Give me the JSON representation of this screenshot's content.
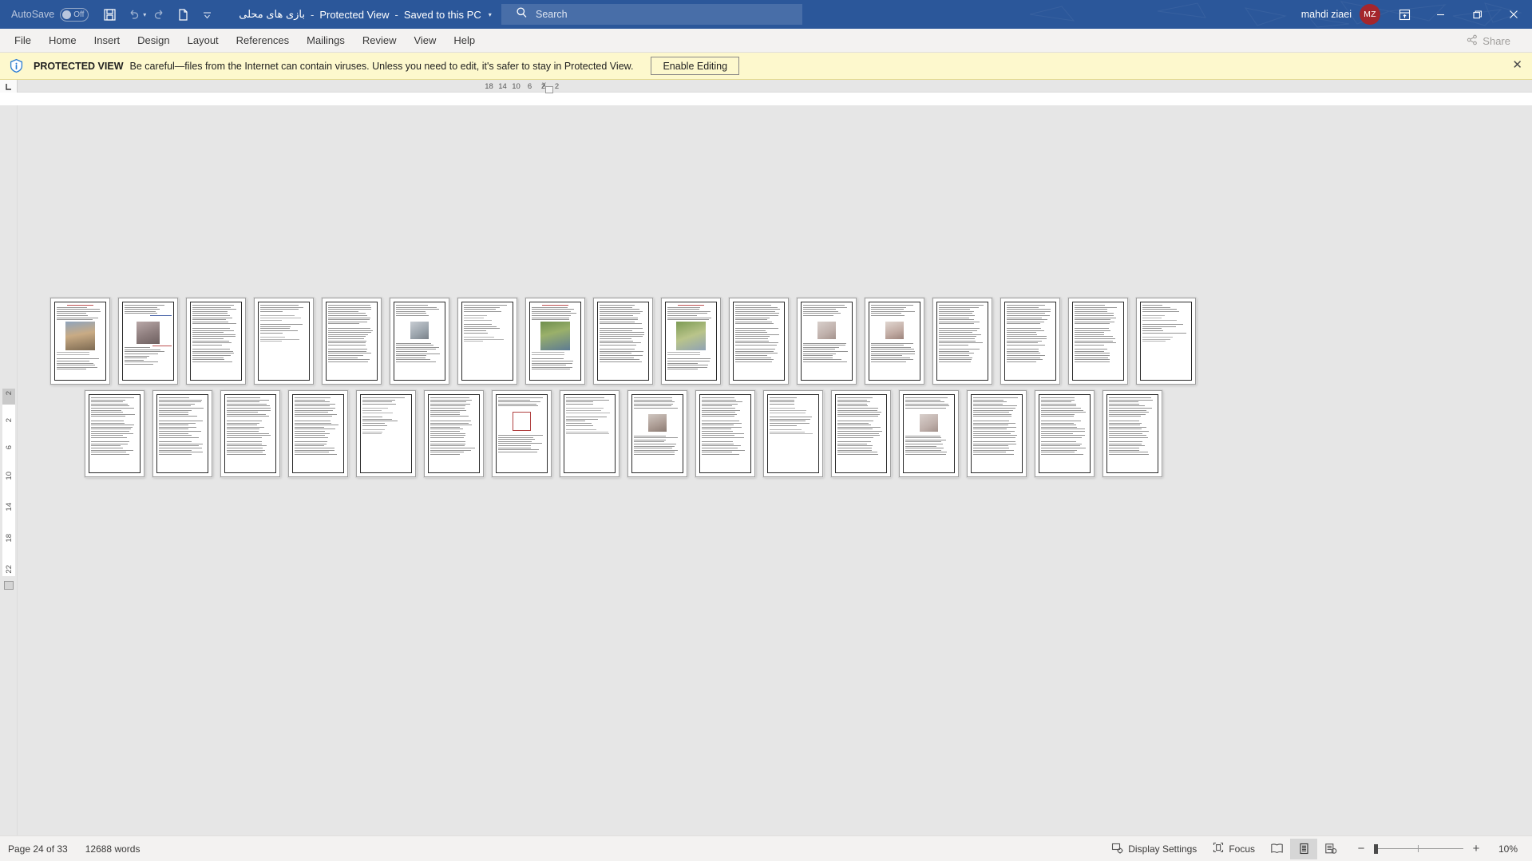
{
  "titlebar": {
    "autosave_label": "AutoSave",
    "autosave_state": "Off",
    "save_icon": "save-icon",
    "undo_icon": "undo-icon",
    "redo_icon": "redo-icon",
    "newdoc_icon": "new-document-icon",
    "customize_icon": "customize-quick-access-toolbar-icon",
    "doc_name": "بازی های محلی",
    "sep1": "-",
    "mode": "Protected View",
    "sep2": "-",
    "saved_location": "Saved to this PC",
    "title_dropdown_icon": "chevron-down-icon",
    "search_placeholder": "Search",
    "search_value": "",
    "search_icon": "search-icon",
    "account_name": "mahdi ziaei",
    "account_initials": "MZ",
    "ribbon_display_icon": "ribbon-display-options-icon",
    "minimize_icon": "minimize-icon",
    "restore_icon": "restore-icon",
    "close_icon": "close-icon",
    "accent_color": "#2b579a",
    "avatar_color": "#a4262c"
  },
  "ribbon": {
    "tabs": [
      {
        "label": "File"
      },
      {
        "label": "Home"
      },
      {
        "label": "Insert"
      },
      {
        "label": "Design"
      },
      {
        "label": "Layout"
      },
      {
        "label": "References"
      },
      {
        "label": "Mailings"
      },
      {
        "label": "Review"
      },
      {
        "label": "View"
      },
      {
        "label": "Help"
      }
    ],
    "share_label": "Share",
    "share_icon": "share-icon"
  },
  "protected_view": {
    "icon": "shield-info-icon",
    "title": "PROTECTED VIEW",
    "message": "Be careful—files from the Internet can contain viruses. Unless you need to edit, it's safer to stay in Protected View.",
    "enable_button": "Enable Editing",
    "close_icon": "close-icon",
    "background_color": "#fdf8cd"
  },
  "rulers": {
    "tab_selector_icon": "left-tab-stop-icon",
    "horizontal_numbers": [
      "18",
      "14",
      "10",
      "6",
      "2",
      "2"
    ],
    "horizontal_marker": "x",
    "vertical_numbers": [
      "2",
      "2",
      "6",
      "10",
      "14",
      "18",
      "22"
    ]
  },
  "document": {
    "zoom_display": "10%",
    "row1_pages": [
      {
        "layout": "photo-top",
        "image": "photo1",
        "heading_color": "#b03030"
      },
      {
        "layout": "photo-mid",
        "image": "photo2",
        "heading_color": "#b03030"
      },
      {
        "layout": "text-dense",
        "image": null
      },
      {
        "layout": "text-sparse",
        "image": null
      },
      {
        "layout": "text-dense",
        "image": null
      },
      {
        "layout": "photo-small",
        "image": "photo3"
      },
      {
        "layout": "text-sparse",
        "image": null
      },
      {
        "layout": "photo-top",
        "image": "photo4"
      },
      {
        "layout": "text-dense",
        "image": null
      },
      {
        "layout": "photo-top",
        "image": "photo5"
      },
      {
        "layout": "text-dense",
        "image": null
      },
      {
        "layout": "photo-small",
        "image": "photo6"
      },
      {
        "layout": "photo-small",
        "image": "photo7"
      },
      {
        "layout": "text-dense",
        "image": null
      },
      {
        "layout": "text-dense",
        "image": null
      },
      {
        "layout": "text-dense",
        "image": null
      },
      {
        "layout": "text-sparse",
        "image": null
      }
    ],
    "row2_pages": [
      {
        "layout": "text-dense",
        "image": null
      },
      {
        "layout": "text-dense",
        "image": null
      },
      {
        "layout": "text-dense",
        "image": null
      },
      {
        "layout": "text-dense",
        "image": null
      },
      {
        "layout": "text-sparse",
        "image": null
      },
      {
        "layout": "text-dense",
        "image": null
      },
      {
        "layout": "chart",
        "image": "chart"
      },
      {
        "layout": "text-sparse",
        "image": null
      },
      {
        "layout": "photo-small",
        "image": "photo8"
      },
      {
        "layout": "text-dense",
        "image": null
      },
      {
        "layout": "text-sparse",
        "image": null
      },
      {
        "layout": "text-dense",
        "image": null
      },
      {
        "layout": "photo-small",
        "image": "photo6"
      },
      {
        "layout": "text-dense",
        "image": null
      },
      {
        "layout": "text-dense",
        "image": null
      },
      {
        "layout": "text-dense",
        "image": null
      }
    ]
  },
  "statusbar": {
    "page_label": "Page 24 of 33",
    "word_count": "12688 words",
    "display_settings": "Display Settings",
    "display_settings_icon": "display-settings-icon",
    "focus": "Focus",
    "focus_icon": "focus-icon",
    "read_mode_icon": "read-mode-icon",
    "print_layout_icon": "print-layout-icon",
    "web_layout_icon": "web-layout-icon",
    "zoom_out_icon": "minus-icon",
    "zoom_in_icon": "plus-icon",
    "zoom_level": "10%"
  }
}
